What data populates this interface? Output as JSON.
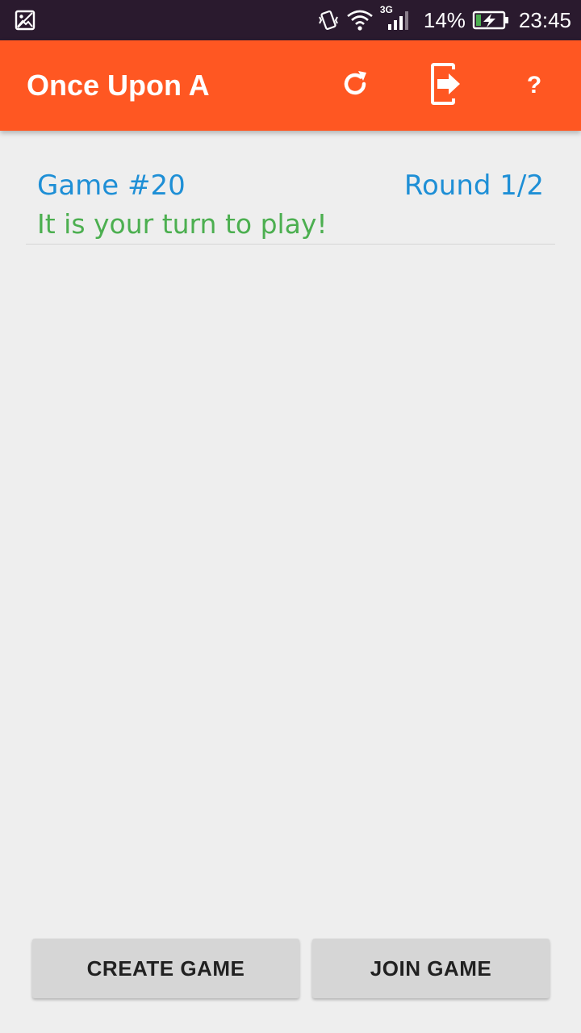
{
  "status_bar": {
    "left_icon": "image-notification-icon",
    "icons": [
      "vibrate-icon",
      "wifi-icon",
      "signal-3g-icon",
      "battery-charging-icon"
    ],
    "network_label": "3G",
    "battery_percent": "14%",
    "time": "23:45"
  },
  "app_bar": {
    "title": "Once Upon A",
    "actions": [
      {
        "name": "refresh",
        "icon": "refresh-icon"
      },
      {
        "name": "exit",
        "icon": "exit-icon"
      },
      {
        "name": "help",
        "icon": "help-icon",
        "glyph": "?"
      }
    ]
  },
  "games": [
    {
      "number": "Game #20",
      "round": "Round 1/2",
      "status": "It is your turn to play!"
    }
  ],
  "buttons": {
    "create": "CREATE GAME",
    "join": "JOIN GAME"
  },
  "colors": {
    "status_bar": "#2A1A2E",
    "app_bar": "#FF5722",
    "background": "#EEEEEE",
    "game_text_blue": "#1E8FD6",
    "turn_text_green": "#4CAF50",
    "button_bg": "#D6D6D6",
    "button_text": "#212121"
  }
}
